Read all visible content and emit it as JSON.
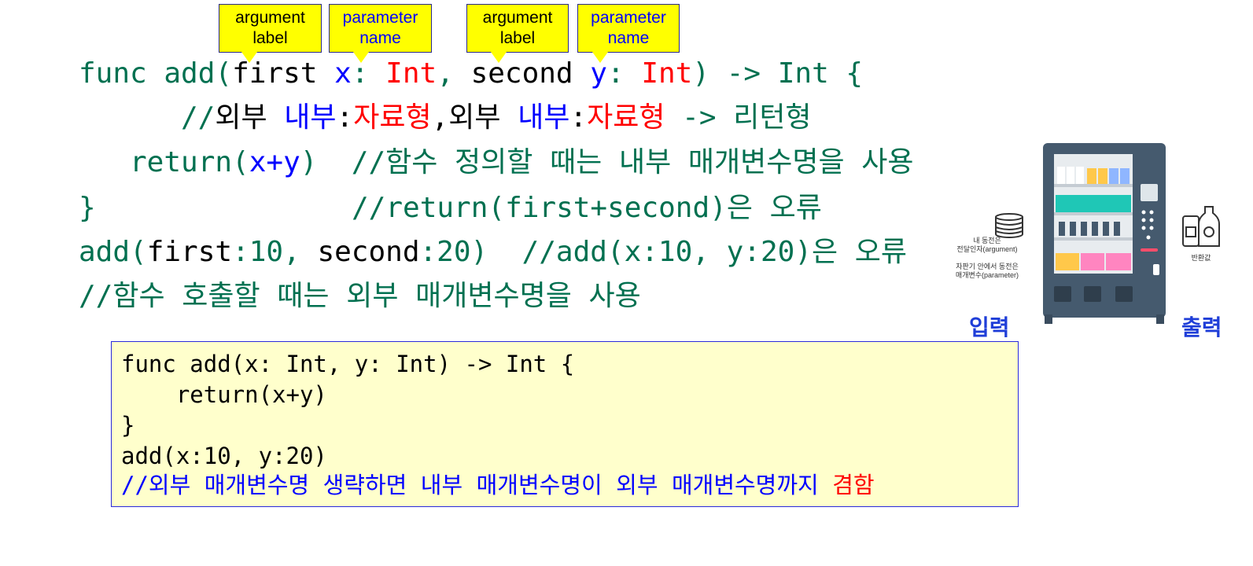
{
  "callouts": [
    {
      "line1": "argument",
      "line2": "label",
      "color": "#000000"
    },
    {
      "line1": "parameter",
      "line2": "name",
      "color": "#0000ff"
    },
    {
      "line1": "argument",
      "line2": "label",
      "color": "#000000"
    },
    {
      "line1": "parameter",
      "line2": "name",
      "color": "#0000ff"
    }
  ],
  "code": {
    "line1": {
      "p1": "func add(",
      "p2": "first ",
      "p3": "x",
      "p4": ": ",
      "p5": "Int",
      "p6": ", ",
      "p7": "second ",
      "p8": "y",
      "p9": ": ",
      "p10": "Int",
      "p11": ") -> Int {"
    },
    "line2": {
      "p1": "//",
      "p2": "외부 ",
      "p3": "내부",
      "p4": ":",
      "p5": "자료형",
      "p6": ",외부 ",
      "p7": "내부",
      "p8": ":",
      "p9": "자료형",
      "p10": " -> 리턴형"
    },
    "line3": {
      "p1": "return(",
      "p2": "x+y",
      "p3": ")  //함수 정의할 때는 내부 매개변수명을 사용"
    },
    "line4": {
      "p1": "}",
      "p2": "//return(first+second)은 오류"
    },
    "line5": {
      "p1": "add(",
      "p2": "first",
      "p3": ":10, ",
      "p4": "second",
      "p5": ":20)  //add(x:10, y:20)은 오류"
    },
    "line6": {
      "p1": "//함수 호출할 때는 외부 매개변수명을 사용"
    }
  },
  "box": {
    "line1": "func add(x: Int, y: Int) -> Int {",
    "line2": "    return(x+y)",
    "line3": "}",
    "line4": "add(x:10, y:20)",
    "line5a": "//외부 매개변수명 생략하면 내부 매개변수명이 외부 매개변수명까지 ",
    "line5b": "겸함"
  },
  "illustration": {
    "coin_caption1": "내 동전은",
    "coin_caption2": "전달인자(argument)",
    "coin_caption3": "자판기 안에서 동전은",
    "coin_caption4": "매개변수(parameter)",
    "drink_caption": "반환값",
    "input_label": "입력",
    "output_label": "출력"
  }
}
